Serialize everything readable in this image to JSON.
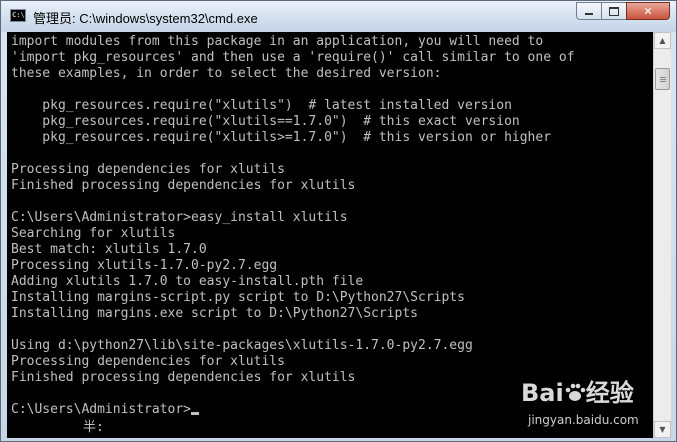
{
  "window": {
    "title": "管理员: C:\\windows\\system32\\cmd.exe",
    "icon_text": "C:\\"
  },
  "controls": {
    "minimize": "minimize",
    "maximize": "maximize",
    "close_glyph": "✕"
  },
  "console": {
    "lines": [
      "import modules from this package in an application, you will need to",
      "'import pkg_resources' and then use a 'require()' call similar to one of",
      "these examples, in order to select the desired version:",
      "",
      "    pkg_resources.require(\"xlutils\")  # latest installed version",
      "    pkg_resources.require(\"xlutils==1.7.0\")  # this exact version",
      "    pkg_resources.require(\"xlutils>=1.7.0\")  # this version or higher",
      "",
      "",
      "Processing dependencies for xlutils",
      "Finished processing dependencies for xlutils",
      "",
      "C:\\Users\\Administrator>easy_install xlutils",
      "Searching for xlutils",
      "Best match: xlutils 1.7.0",
      "Processing xlutils-1.7.0-py2.7.egg",
      "Adding xlutils 1.7.0 to easy-install.pth file",
      "Installing margins-script.py script to D:\\Python27\\Scripts",
      "Installing margins.exe script to D:\\Python27\\Scripts",
      "",
      "Using d:\\python27\\lib\\site-packages\\xlutils-1.7.0-py2.7.egg",
      "Processing dependencies for xlutils",
      "Finished processing dependencies for xlutils",
      "",
      "C:\\Users\\Administrator>"
    ],
    "ime_indicator": "半:"
  },
  "watermark": {
    "brand": "Bai",
    "brand2": "经验",
    "url": "jingyan.baidu.com"
  },
  "scrollbar": {
    "up_glyph": "▲",
    "down_glyph": "▼"
  }
}
